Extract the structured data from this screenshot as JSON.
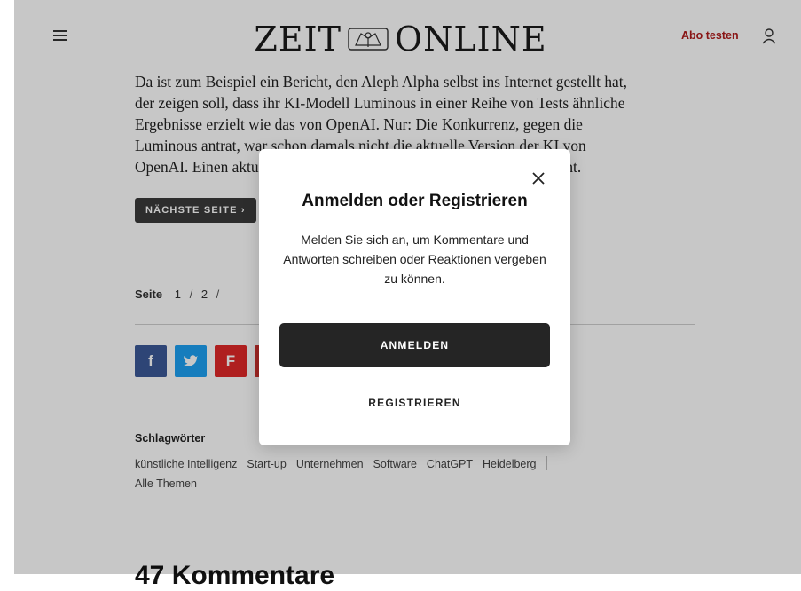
{
  "header": {
    "logo_left": "ZEIT",
    "logo_right": "ONLINE",
    "abo_link": "Abo testen",
    "icons": [
      "menu-icon",
      "eagle-crest",
      "user-icon"
    ]
  },
  "article": {
    "lines": [
      "Da ist zum Beispiel ein Bericht, den Aleph Alpha selbst ins Internet gestellt hat,",
      "der zeigen soll, dass ihr KI-Modell Luminous in einer Reihe von Tests ähnliche",
      "Ergebnisse erzielt wie das von OpenAI. Nur: Die Konkurrenz, gegen die",
      "Luminous antrat, war schon damals nicht die aktuelle Version der KI von",
      "OpenAI. Einen aktuellen Vergleich hat Aleph Alpha nicht veröffentlicht."
    ],
    "next_page": "NÄCHSTE SEITE ›"
  },
  "pager": {
    "label": "Seite",
    "pages": [
      "1",
      "2",
      "/"
    ]
  },
  "share": {
    "icons": [
      "facebook-icon",
      "twitter-icon",
      "flipboard-icon",
      "more-share-icon"
    ],
    "facebook": "f",
    "twitter": "🐦",
    "flipboard": "F"
  },
  "tags": {
    "title": "Schlagwörter",
    "items": [
      "künstliche Intelligenz",
      "Start-up",
      "Unternehmen",
      "Software",
      "ChatGPT",
      "Heidelberg"
    ],
    "all": "Alle Themen"
  },
  "comments": {
    "heading": "47 Kommentare"
  },
  "modal": {
    "title": "Anmelden oder Registrieren",
    "text": "Melden Sie sich an, um Kommentare und Antworten schreiben oder Reaktionen vergeben zu können.",
    "login": "ANMELDEN",
    "register": "REGISTRIEREN",
    "close_icon": "close-icon"
  },
  "colors": {
    "brand_red": "#b01c1c",
    "dark_button": "#252525",
    "facebook": "#3b5998",
    "twitter": "#1da1f2",
    "flipboard": "#e12828"
  }
}
